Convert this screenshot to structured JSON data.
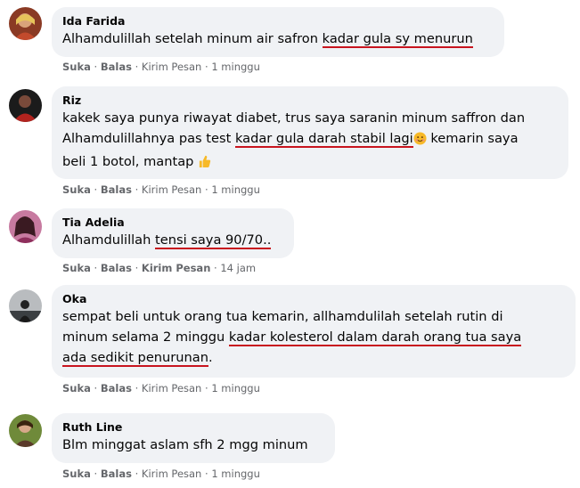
{
  "comments": [
    {
      "name": "Ida Farida",
      "text_before": "Alhamdulillah setelah minum air safron ",
      "highlight": "kadar gula sy menurun",
      "text_after": "",
      "like": "Suka",
      "reply": "Balas",
      "message": "Kirim Pesan",
      "time": "1 minggu"
    },
    {
      "name": "Riz",
      "line1": "kakek saya punya riwayat diabet, trus saya saranin minum saffron dan",
      "line2_before": "Alhamdulillahnya pas test ",
      "highlight": "kadar gula darah stabil lagi",
      "line2_after": " kemarin saya",
      "line3": "beli 1 botol, mantap",
      "emoji1": "smiling-face-emoji",
      "emoji2": "thumbs-up-emoji",
      "like": "Suka",
      "reply": "Balas",
      "message": "Kirim Pesan",
      "time": "1 minggu"
    },
    {
      "name": "Tia Adelia",
      "text_before": "Alhamdulillah ",
      "highlight": "tensi saya 90/70..",
      "like": "Suka",
      "reply": "Balas",
      "message": "Kirim Pesan",
      "time": "14 jam"
    },
    {
      "name": "Oka",
      "line1": "sempat beli untuk orang tua kemarin, allhamdulilah setelah rutin di",
      "line2_before": "minum selama 2 minggu ",
      "highlight_a": "kadar kolesterol dalam darah orang tua saya",
      "highlight_b": "ada sedikit penurunan",
      "line3_after": ".",
      "like": "Suka",
      "reply": "Balas",
      "message": "Kirim Pesan",
      "time": "1 minggu"
    },
    {
      "name": "Ruth Line",
      "text": "Blm minggat aslam sfh 2 mgg minum",
      "like": "Suka",
      "reply": "Balas",
      "message": "Kirim Pesan",
      "time": "1 minggu"
    }
  ],
  "colors": {
    "bubble": "#f0f2f5",
    "underline": "#c8141e",
    "meta": "#65676b"
  }
}
